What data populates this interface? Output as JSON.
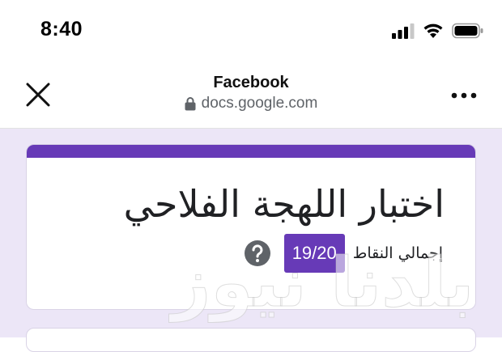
{
  "status_bar": {
    "time": "8:40",
    "icons": [
      "cellular-signal-icon",
      "wifi-icon",
      "battery-icon"
    ]
  },
  "browser": {
    "title": "Facebook",
    "url": "docs.google.com",
    "close_icon": "close-icon",
    "lock_icon": "lock-icon",
    "more_icon": "more-icon"
  },
  "form": {
    "title": "اختبار اللهجة الفلاحي",
    "score_label": "إجمالي النقاط",
    "score": "19/20",
    "help_icon": "help-icon"
  },
  "watermark": {
    "text": "بلدنا نيوز"
  },
  "colors": {
    "accent": "#673ab7",
    "form_background": "#ece6f7",
    "card_background": "#ffffff"
  }
}
